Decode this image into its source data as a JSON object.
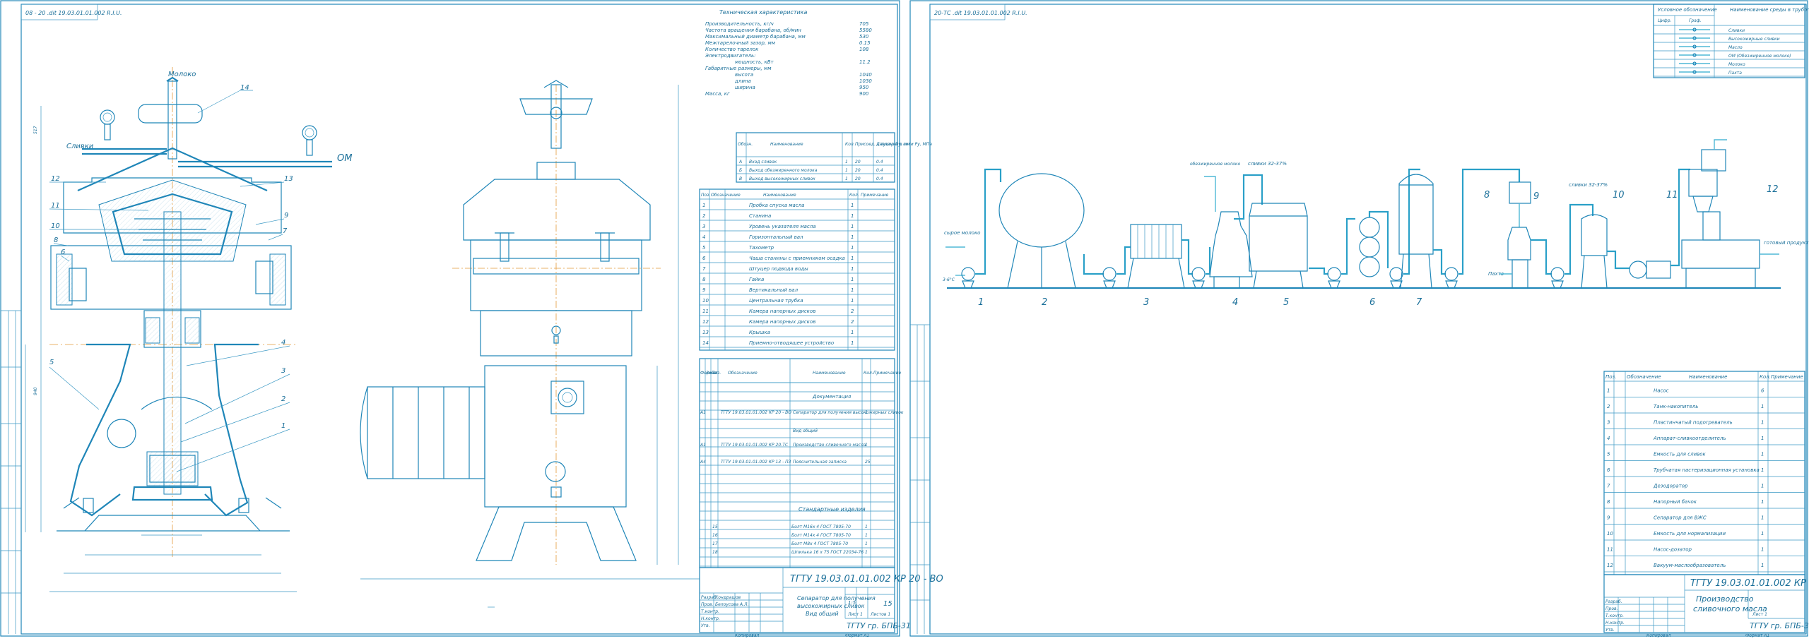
{
  "sheet_left": {
    "stamp_code": "08 - 20 .dit 19.03.01.01.002 R.I.U.",
    "inlet_label": "Молоко",
    "cream_label": "Сливки",
    "om_label": "ОМ",
    "callouts": [
      "14",
      "12",
      "13",
      "11",
      "10",
      "9",
      "8",
      "7",
      "6",
      "5",
      "4",
      "3",
      "2",
      "1"
    ],
    "specs_title": "Техническая характеристика",
    "specs": [
      {
        "k": "Производительность, кг/ч",
        "v": "705"
      },
      {
        "k": "Частота вращения барабана, об/мин",
        "v": "5580"
      },
      {
        "k": "Максимальный диаметр барабана, мм",
        "v": "530"
      },
      {
        "k": "Межтарелочный зазор, мм",
        "v": "0.15"
      },
      {
        "k": "Количество тарелок",
        "v": "108"
      },
      {
        "k": "Электродвигатель:",
        "v": ""
      },
      {
        "k": "мощность, кВт",
        "v": "11.2"
      },
      {
        "k": "Габаритные размеры, мм",
        "v": ""
      },
      {
        "k": "высота",
        "v": "1040"
      },
      {
        "k": "длина",
        "v": "1030"
      },
      {
        "k": "ширина",
        "v": "950"
      },
      {
        "k": "Масса, кг",
        "v": "900"
      }
    ],
    "conn_table": {
      "headers": [
        "Обозн.",
        "Наименование",
        "Кол.",
        "Присоед. штуцер Dy, мм",
        "Давление в сети Ру, МПа"
      ],
      "rows": [
        [
          "А",
          "Вход сливок",
          "1",
          "20",
          "0.4"
        ],
        [
          "Б",
          "Выход обезжиренного молока",
          "1",
          "20",
          "0.4"
        ],
        [
          "В",
          "Выход высокожирных сливок",
          "1",
          "20",
          "0.4"
        ]
      ]
    },
    "parts_table": {
      "headers": [
        "Поз.",
        "Обозначение",
        "Наименование",
        "Кол.",
        "Примечание"
      ],
      "rows": [
        [
          "1",
          "",
          "Пробка спуска масла",
          "1",
          ""
        ],
        [
          "2",
          "",
          "Станина",
          "1",
          ""
        ],
        [
          "3",
          "",
          "Уровень указателя масла",
          "1",
          ""
        ],
        [
          "4",
          "",
          "Горизонтальный вал",
          "1",
          ""
        ],
        [
          "5",
          "",
          "Тахометр",
          "1",
          ""
        ],
        [
          "6",
          "",
          "Чаша станины с приемником осадка",
          "1",
          ""
        ],
        [
          "7",
          "",
          "Штуцер подвода воды",
          "1",
          ""
        ],
        [
          "8",
          "",
          "Гайка",
          "1",
          ""
        ],
        [
          "9",
          "",
          "Вертикальный вал",
          "1",
          ""
        ],
        [
          "10",
          "",
          "Центральная трубка",
          "1",
          ""
        ],
        [
          "11",
          "",
          "Камера напорных дисков",
          "2",
          ""
        ],
        [
          "12",
          "",
          "Камера напорных дисков",
          "2",
          ""
        ],
        [
          "13",
          "",
          "Крышка",
          "1",
          ""
        ],
        [
          "14",
          "",
          "Приемно-отводящее устройство",
          "1",
          ""
        ]
      ]
    },
    "spec_sheet": {
      "headers": [
        "Формат",
        "Зона",
        "Поз.",
        "Обозначение",
        "Наименование",
        "Кол.",
        "Примечание"
      ],
      "section_doc": "Документация",
      "rows": [
        {
          "fmt": "А1",
          "des": "ТГТУ 19.03.01.01.002 КР 20 - ВО",
          "name": "Сепаратор для получения высокожирных сливок",
          "qty": "1"
        },
        {
          "fmt": "",
          "des": "",
          "name": "Вид общий",
          "qty": ""
        },
        {
          "fmt": "А1",
          "des": "ТГТУ 19.03.01.01.002 КР 20-ТС",
          "name": "Производство сливочного масла",
          "qty": "1"
        },
        {
          "fmt": "А4",
          "des": "ТГТУ 19.03.01.01.002 КР 13 - ПЗ",
          "name": "Пояснительная записка",
          "qty": "25"
        }
      ],
      "section_std": "Стандартные изделия",
      "std_rows": [
        {
          "pos": "15",
          "des": "Болт М16х 4 ГОСТ 7805-70",
          "qty": "1"
        },
        {
          "pos": "16",
          "des": "Болт М14х 4 ГОСТ 7805-70",
          "qty": "1"
        },
        {
          "pos": "17",
          "des": "Болт М8х 4 ГОСТ 7805-70",
          "qty": "1"
        },
        {
          "pos": "18",
          "des": "Шпилька 16 х 75 ГОСТ 22034-76",
          "qty": "1"
        }
      ]
    },
    "title_block": {
      "code": "ТГТУ 19.03.01.01.002 КР 20 - ВО",
      "name_lines": [
        "Сепаратор для получения",
        "высокожирных сливок",
        "Вид общий"
      ],
      "scale": "1:5",
      "mass": "15",
      "sheet": "Лист 1",
      "sheets": "Листов 1",
      "group": "ТГТУ гр. БПБ-31",
      "roles": [
        "Разраб.",
        "Пров.",
        "Т.контр.",
        "Н.контр.",
        "Утв."
      ],
      "people": [
        "Кондрашов",
        "Белоусова А.Л."
      ],
      "copy": "Копировал",
      "format": "Формат А1"
    }
  },
  "sheet_right": {
    "stamp_code": "20-ТС .dit 19.03.01.01.002 R.I.U.",
    "legend": {
      "header_main": "Условное обозначение",
      "sub_code": "Цифр.",
      "sub_graph": "Граф.",
      "header_env": "Наименование среды в трубопроводе",
      "rows": [
        "Сливки",
        "Высокожирные сливки",
        "Масло",
        "ОМ (Обезжиренное молоко)",
        "Молоко",
        "Пахта"
      ]
    },
    "flow_labels": {
      "raw_milk": "сырое молоко",
      "skim_milk": "обезжиренное молоко",
      "cream1": "сливки 32-37%",
      "cream2": "сливки 32-37%",
      "buttermilk": "Пахта",
      "product": "готовый продукт",
      "temp": "3-6°С"
    },
    "equipment_numbers": [
      "1",
      "2",
      "3",
      "4",
      "5",
      "6",
      "7",
      "8",
      "9",
      "10",
      "11",
      "12"
    ],
    "equipment_table": {
      "headers": [
        "Поз.",
        "Обозначение",
        "Наименование",
        "Кол.",
        "Примечание"
      ],
      "rows": [
        [
          "1",
          "",
          "Насос",
          "6",
          ""
        ],
        [
          "2",
          "",
          "Танк-накопитель",
          "1",
          ""
        ],
        [
          "3",
          "",
          "Пластинчатый подогреватель",
          "1",
          ""
        ],
        [
          "4",
          "",
          "Аппарат-сливкоотделитель",
          "1",
          ""
        ],
        [
          "5",
          "",
          "Емкость для сливок",
          "1",
          ""
        ],
        [
          "6",
          "",
          "Трубчатая пастеризационная установка",
          "1",
          ""
        ],
        [
          "7",
          "",
          "Дезодоратор",
          "1",
          ""
        ],
        [
          "8",
          "",
          "Напорный бачок",
          "1",
          ""
        ],
        [
          "9",
          "",
          "Сепаратор для ВЖС",
          "1",
          ""
        ],
        [
          "10",
          "",
          "Емкость для нормализации",
          "1",
          ""
        ],
        [
          "11",
          "",
          "Насос-дозатор",
          "1",
          ""
        ],
        [
          "12",
          "",
          "Вакуум-маслообразователь",
          "1",
          ""
        ]
      ]
    },
    "title_block": {
      "code": "ТГТУ 19.03.01.01.002 КР 20-ТС",
      "name_lines": [
        "Производство",
        "сливочного масла"
      ],
      "sheet": "Лист 1",
      "group": "ТГТУ гр. БПБ-31",
      "roles": [
        "Разраб.",
        "Пров.",
        "Т.контр.",
        "Н.контр.",
        "Утв."
      ],
      "copy": "Копировал",
      "format": "Формат А1"
    }
  }
}
